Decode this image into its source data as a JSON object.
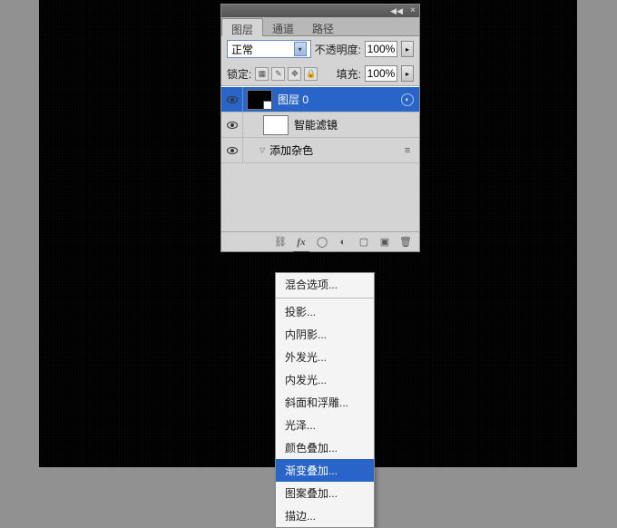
{
  "tabs": {
    "layers": "图层",
    "channels": "通道",
    "paths": "路径"
  },
  "blend": {
    "mode": "正常",
    "opacity_label": "不透明度:",
    "opacity_value": "100%"
  },
  "lock": {
    "label": "锁定:",
    "fill_label": "填充:",
    "fill_value": "100%"
  },
  "layers": [
    {
      "name": "图层 0"
    },
    {
      "name": "智能滤镜"
    },
    {
      "name": "添加杂色"
    }
  ],
  "fx_menu": {
    "blending": "混合选项...",
    "drop_shadow": "投影...",
    "inner_shadow": "内阴影...",
    "outer_glow": "外发光...",
    "inner_glow": "内发光...",
    "bevel": "斜面和浮雕...",
    "satin": "光泽...",
    "color_overlay": "颜色叠加...",
    "gradient_overlay": "渐变叠加...",
    "pattern_overlay": "图案叠加...",
    "stroke": "描边..."
  }
}
